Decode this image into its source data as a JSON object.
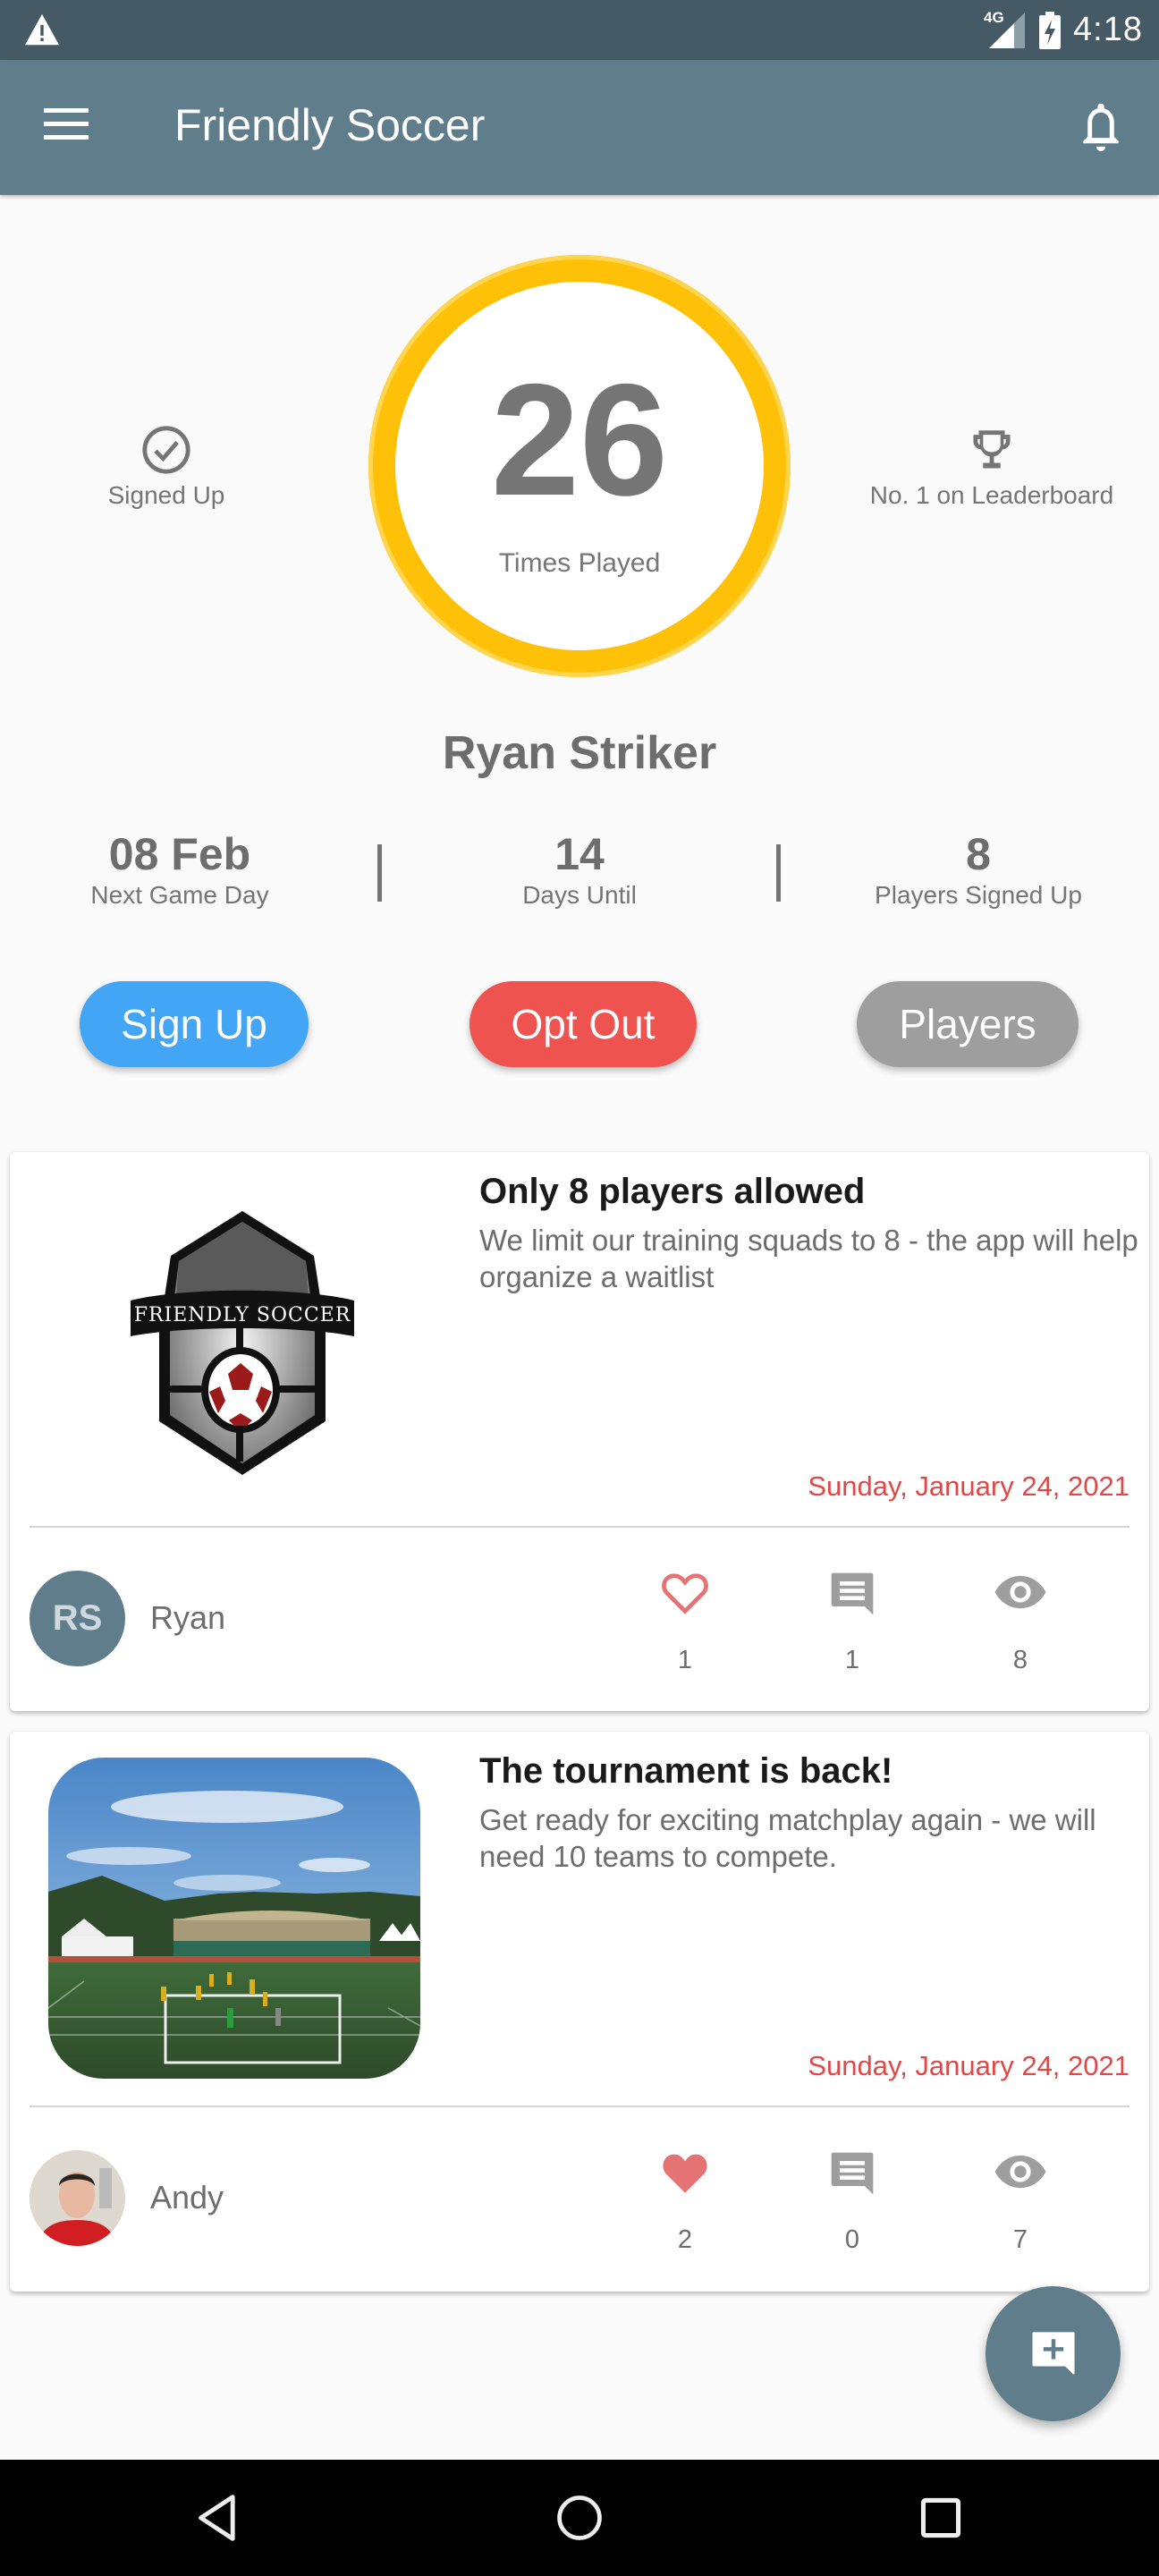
{
  "status_bar": {
    "alert_icon": "warning-icon",
    "network": "4G",
    "time": "4:18"
  },
  "toolbar": {
    "menu_icon": "hamburger-menu-icon",
    "title": "Friendly Soccer",
    "notification_icon": "bell-icon"
  },
  "hero": {
    "signed_up_label": "Signed Up",
    "times_played_value": "26",
    "times_played_label": "Times Played",
    "leaderboard_label": "No. 1 on Leaderboard",
    "player_name": "Ryan Striker"
  },
  "stats": [
    {
      "value": "08 Feb",
      "label": "Next Game Day"
    },
    {
      "value": "14",
      "label": "Days Until"
    },
    {
      "value": "8",
      "label": "Players Signed Up"
    }
  ],
  "actions": {
    "sign_up": "Sign Up",
    "opt_out": "Opt Out",
    "players": "Players"
  },
  "colors": {
    "primary": "#607D8B",
    "primary_dark": "#455A64",
    "accent_ring": "#FFC107",
    "sign_up": "#42A5F5",
    "opt_out": "#EF5350",
    "players": "#9E9E9E",
    "date": "#E04848",
    "like": "#E57373"
  },
  "posts": [
    {
      "image": "friendly-soccer-logo",
      "image_badge_text": "FRIENDLY SOCCER",
      "title": "Only 8 players allowed",
      "body": "We limit our training squads to 8 - the app will help organize a waitlist",
      "date": "Sunday, January 24, 2021",
      "author_initials": "RS",
      "author": "Ryan",
      "liked": false,
      "likes": "1",
      "comments": "1",
      "views": "8"
    },
    {
      "image": "soccer-field-photo",
      "title": "The tournament is back!",
      "body": "Get ready for exciting matchplay again - we will need 10 teams to compete.",
      "date": "Sunday, January 24, 2021",
      "author_initials": "",
      "author": "Andy",
      "liked": true,
      "likes": "2",
      "comments": "0",
      "views": "7"
    }
  ],
  "fab": {
    "icon": "add-comment-icon"
  },
  "nav": {
    "back": "back-icon",
    "home": "home-icon",
    "recents": "recents-icon"
  }
}
